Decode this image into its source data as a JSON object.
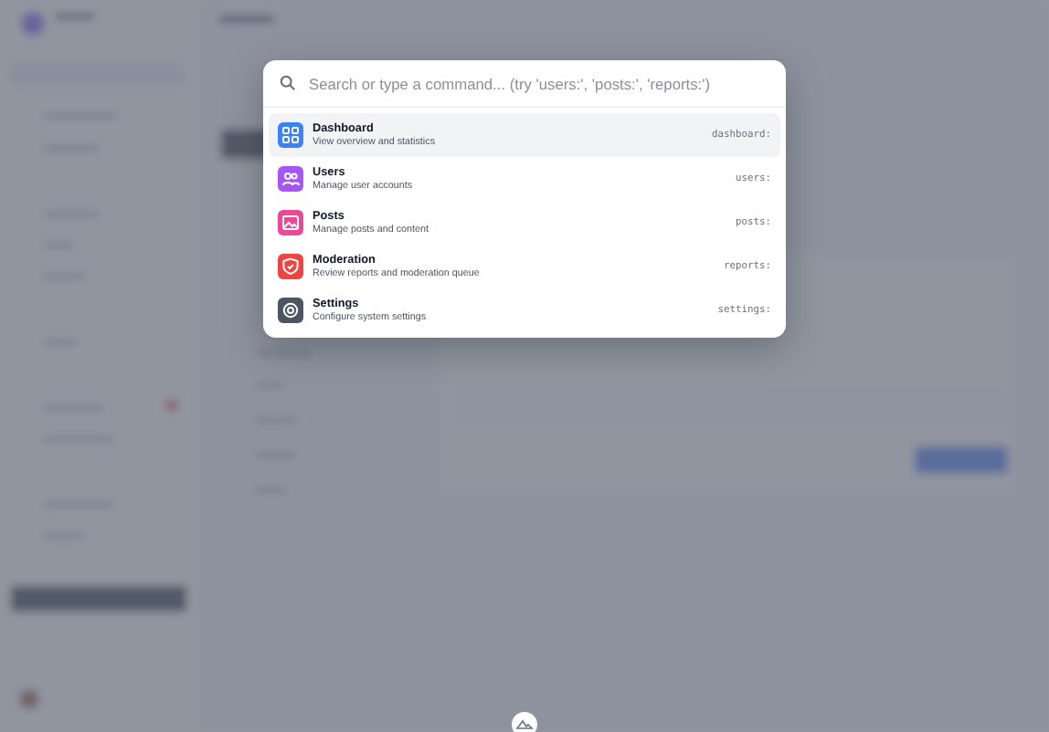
{
  "command_palette": {
    "search": {
      "placeholder": "Search or type a command... (try 'users:', 'posts:', 'reports:')"
    },
    "commands": [
      {
        "label": "Dashboard",
        "description": "View overview and statistics",
        "shortcut": "dashboard:",
        "color": "#3b82f6",
        "selected": true
      },
      {
        "label": "Users",
        "description": "Manage user accounts",
        "shortcut": "users:",
        "color": "#a855f7",
        "selected": false
      },
      {
        "label": "Posts",
        "description": "Manage posts and content",
        "shortcut": "posts:",
        "color": "#ec4899",
        "selected": false
      },
      {
        "label": "Moderation",
        "description": "Review reports and moderation queue",
        "shortcut": "reports:",
        "color": "#ef4444",
        "selected": false
      },
      {
        "label": "Settings",
        "description": "Configure system settings",
        "shortcut": "settings:",
        "color": "#4b5563",
        "selected": false
      }
    ]
  }
}
